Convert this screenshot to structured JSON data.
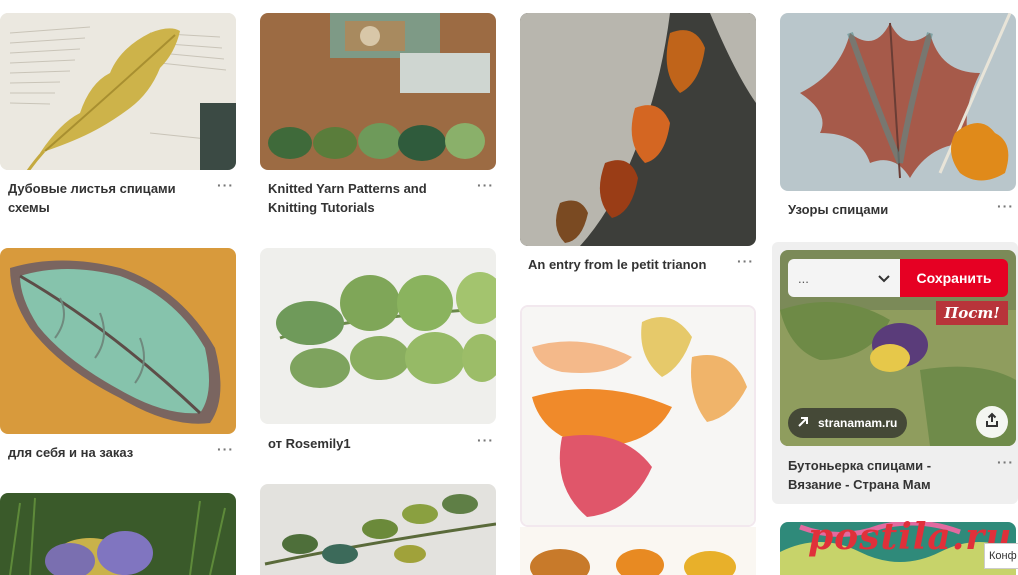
{
  "pins": [
    {
      "title": "Дубовые листья спицами схемы"
    },
    {
      "title": "для себя и на заказ"
    },
    {
      "title": "Knitted Yarn Patterns and Knitting Tutorials"
    },
    {
      "title": "от Rosemily1"
    },
    {
      "title": "An entry from le petit trianon"
    },
    {
      "title": "Узоры спицами"
    },
    {
      "title": "Бутоньерка спицами - Вязание - Страна Мам"
    }
  ],
  "hover_pin": {
    "board_select": "...",
    "save_label": "Сохранить",
    "domain": "stranamam.ru",
    "badge": "Пост!"
  },
  "more_label": "···",
  "watermark": "postila.ru",
  "corner_tip": "Конф",
  "colors": {
    "save_red": "#e60023",
    "hover_bg": "#efefef",
    "title": "#333333"
  }
}
